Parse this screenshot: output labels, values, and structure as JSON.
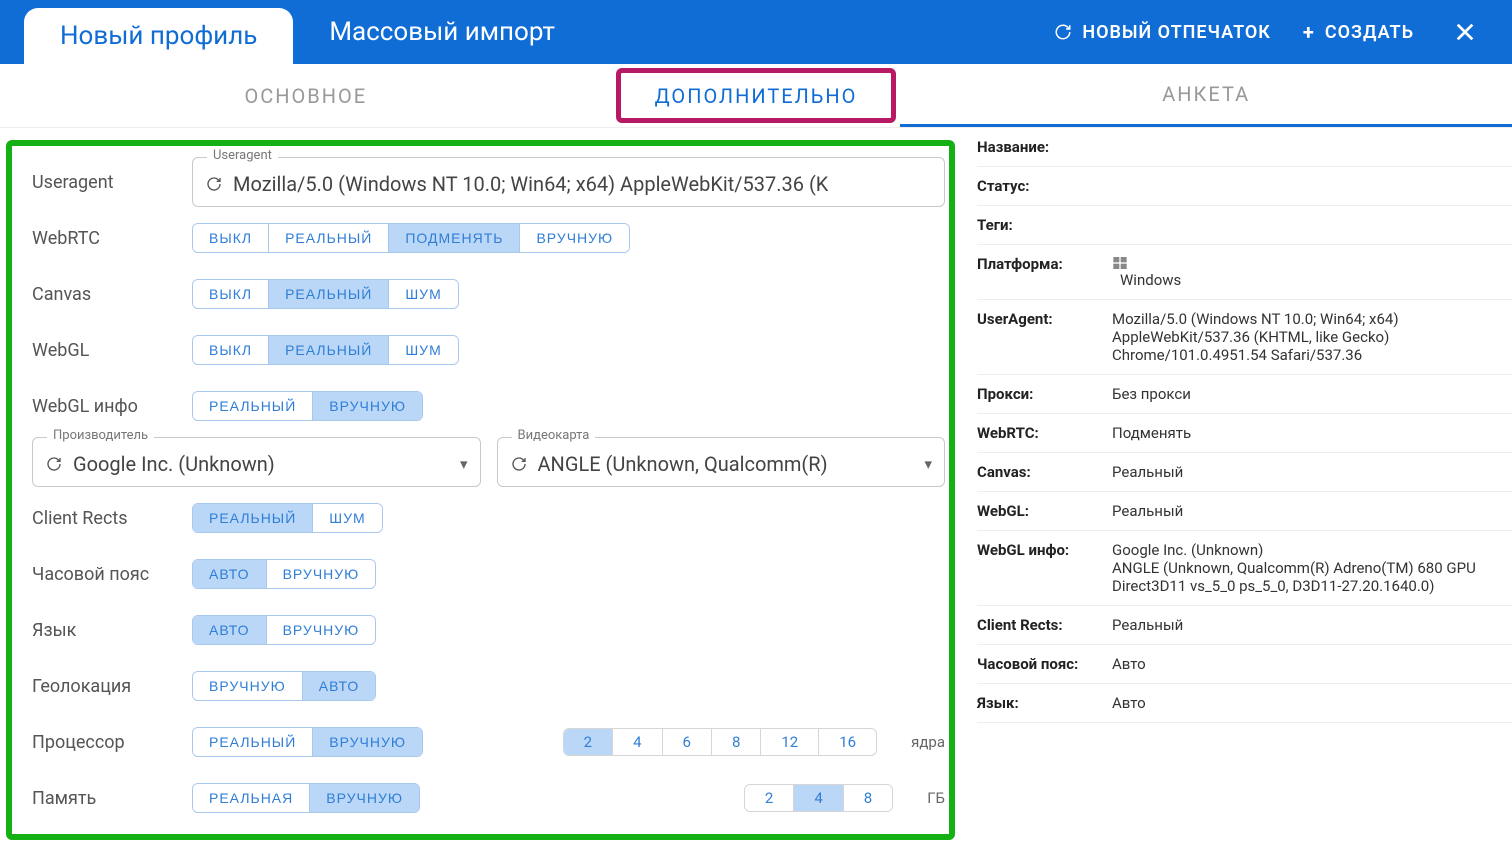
{
  "topbar": {
    "tab_new_profile": "Новый профиль",
    "tab_mass_import": "Массовый импорт",
    "btn_new_fingerprint": "НОВЫЙ ОТПЕЧАТОК",
    "btn_create": "СОЗДАТЬ"
  },
  "subtabs": {
    "basic": "ОСНОВНОЕ",
    "advanced": "ДОПОЛНИТЕЛЬНО",
    "profile": "АНКЕТА"
  },
  "form": {
    "useragent_label": "Useragent",
    "useragent_legend": "Useragent",
    "useragent_value": "Mozilla/5.0 (Windows NT 10.0; Win64; x64) AppleWebKit/537.36 (K",
    "webrtc_label": "WebRTC",
    "webrtc_options": {
      "off": "ВЫКЛ",
      "real": "РЕАЛЬНЫЙ",
      "spoof": "ПОДМЕНЯТЬ",
      "manual": "ВРУЧНУЮ"
    },
    "canvas_label": "Canvas",
    "canvas_options": {
      "off": "ВЫКЛ",
      "real": "РЕАЛЬНЫЙ",
      "noise": "ШУМ"
    },
    "webgl_label": "WebGL",
    "webgl_options": {
      "off": "ВЫКЛ",
      "real": "РЕАЛЬНЫЙ",
      "noise": "ШУМ"
    },
    "webgl_info_label": "WebGL инфо",
    "webgl_info_options": {
      "real": "РЕАЛЬНЫЙ",
      "manual": "ВРУЧНУЮ"
    },
    "vendor_legend": "Производитель",
    "vendor_value": "Google Inc. (Unknown)",
    "gpu_legend": "Видеокарта",
    "gpu_value": "ANGLE (Unknown, Qualcomm(R)",
    "client_rects_label": "Client Rects",
    "client_rects_options": {
      "real": "РЕАЛЬНЫЙ",
      "noise": "ШУМ"
    },
    "timezone_label": "Часовой пояс",
    "timezone_options": {
      "auto": "АВТО",
      "manual": "ВРУЧНУЮ"
    },
    "lang_label": "Язык",
    "lang_options": {
      "auto": "АВТО",
      "manual": "ВРУЧНУЮ"
    },
    "geo_label": "Геолокация",
    "geo_options": {
      "manual": "ВРУЧНУЮ",
      "auto": "АВТО"
    },
    "cpu_label": "Процессор",
    "cpu_options": {
      "real": "РЕАЛЬНЫЙ",
      "manual": "ВРУЧНУЮ"
    },
    "cpu_cores": [
      "2",
      "4",
      "6",
      "8",
      "12",
      "16"
    ],
    "cpu_unit": "ядра",
    "mem_label": "Память",
    "mem_options": {
      "real": "РЕАЛЬНАЯ",
      "manual": "ВРУЧНУЮ"
    },
    "mem_sizes": [
      "2",
      "4",
      "8"
    ],
    "mem_unit": "ГБ"
  },
  "side": {
    "name_k": "Название:",
    "status_k": "Статус:",
    "tags_k": "Теги:",
    "platform_k": "Платформа:",
    "platform_v": "Windows",
    "ua_k": "UserAgent:",
    "ua_v": "Mozilla/5.0 (Windows NT 10.0; Win64; x64) AppleWebKit/537.36 (KHTML, like Gecko) Chrome/101.0.4951.54 Safari/537.36",
    "proxy_k": "Прокси:",
    "proxy_v": "Без прокси",
    "webrtc_k": "WebRTC:",
    "webrtc_v": "Подменять",
    "canvas_k": "Canvas:",
    "canvas_v": "Реальный",
    "webgl_k": "WebGL:",
    "webgl_v": "Реальный",
    "webgl_info_k": "WebGL инфо:",
    "webgl_info_v": "Google Inc. (Unknown)\nANGLE (Unknown, Qualcomm(R) Adreno(TM) 680 GPU Direct3D11 vs_5_0 ps_5_0, D3D11-27.20.1640.0)",
    "cr_k": "Client Rects:",
    "cr_v": "Реальный",
    "tz_k": "Часовой пояс:",
    "tz_v": "Авто",
    "lang_k": "Язык:",
    "lang_v": "Авто"
  }
}
